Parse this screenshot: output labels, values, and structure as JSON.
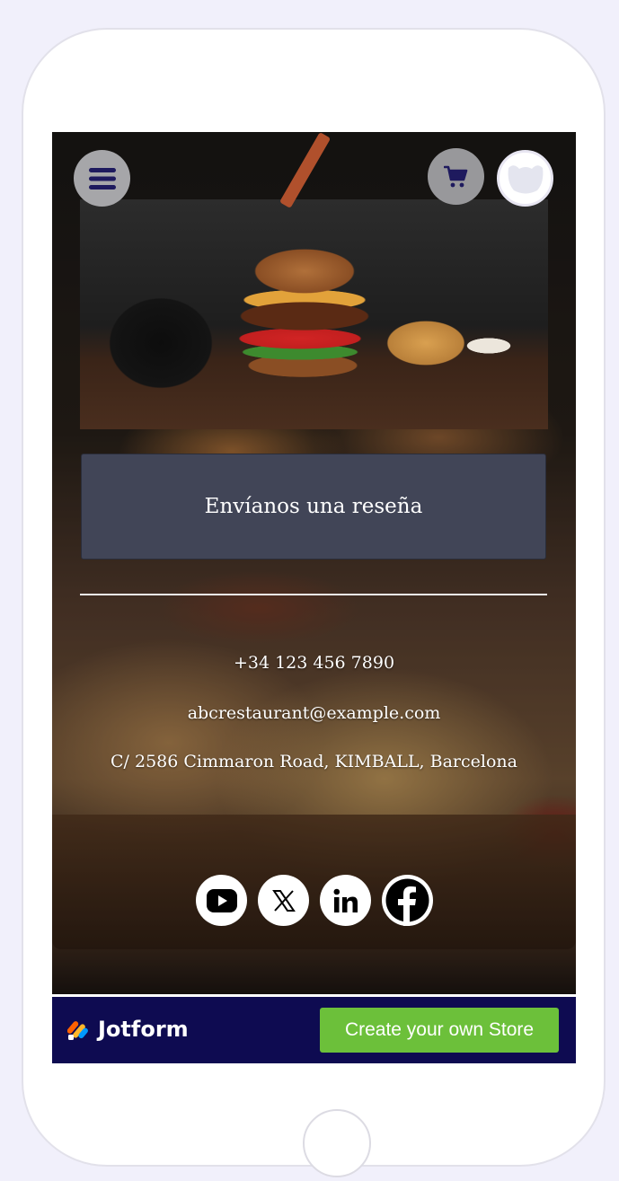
{
  "header": {
    "menu_icon": "hamburger-menu-icon",
    "cart_icon": "shopping-cart-icon",
    "avatar_icon": "store-logo-avatar"
  },
  "main": {
    "review_button_label": "Envíanos una reseña",
    "contact": {
      "phone": "+34 123 456 7890",
      "email": "abcrestaurant@example.com",
      "address": "C/ 2586 Cimmaron Road, KIMBALL, Barcelona"
    },
    "socials": [
      {
        "name": "youtube",
        "icon": "youtube-icon"
      },
      {
        "name": "x",
        "icon": "x-icon"
      },
      {
        "name": "linkedin",
        "icon": "linkedin-icon"
      },
      {
        "name": "facebook",
        "icon": "facebook-icon"
      }
    ]
  },
  "footer": {
    "brand": "Jotform",
    "cta_label": "Create your own Store"
  },
  "colors": {
    "page_bg": "#f1f0fb",
    "review_button": "#414557",
    "footer_bg": "#0e0b51",
    "cta_green": "#6cc03a",
    "icon_navy": "#1e1a5e"
  }
}
